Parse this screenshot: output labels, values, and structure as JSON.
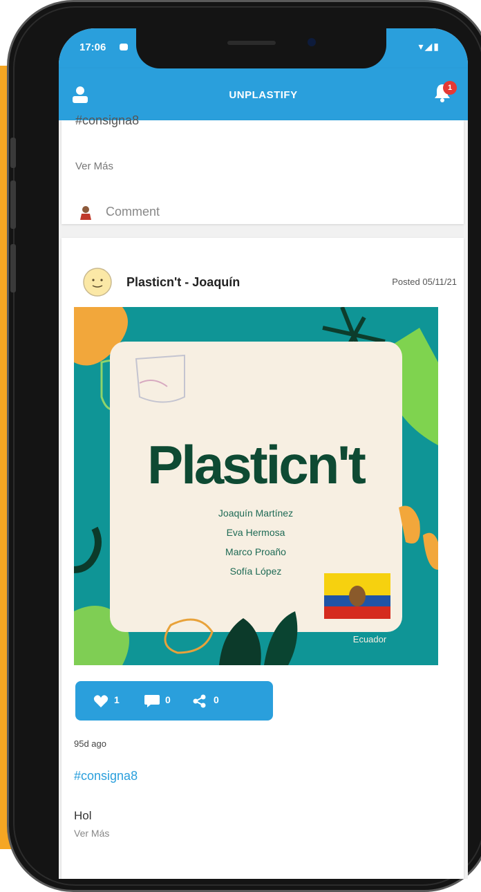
{
  "status_bar": {
    "time": "17:06",
    "right_icons": "▾◢▮"
  },
  "app_bar": {
    "title": "UNPLASTIFY",
    "notification_count": "1"
  },
  "previous_post": {
    "cut_hashtag": "#consigna8",
    "see_more": "Ver Más",
    "comment_label": "Comment"
  },
  "post": {
    "author": "Plasticn't - Joaquín",
    "posted": "Posted 05/11/21",
    "image": {
      "title": "Plasticn't",
      "names": [
        "Joaquín Martínez",
        "Eva Hermosa",
        "Marco Proaño",
        "Sofía López"
      ],
      "country": "Ecuador"
    },
    "likes": "1",
    "comments": "0",
    "shares": "0",
    "time_ago": "95d ago",
    "hashtag": "#consigna8",
    "text": "Hol",
    "see_more": "Ver Más"
  },
  "colors": {
    "accent": "#2a9fdc",
    "orange": "#f5a623",
    "teal": "#0f9596",
    "dark_green": "#0e4a33"
  }
}
